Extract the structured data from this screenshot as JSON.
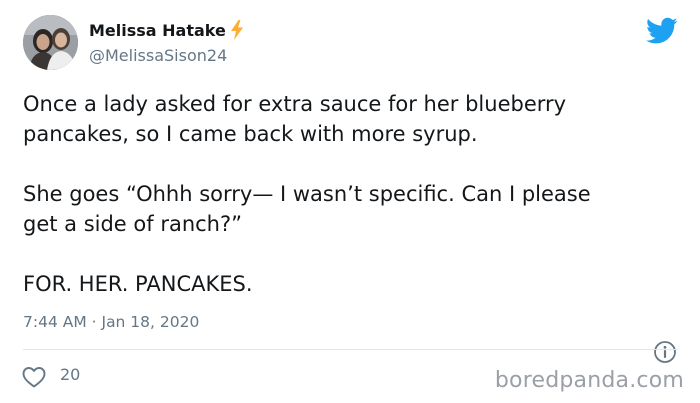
{
  "tweet": {
    "author": {
      "display_name": "Melissa Hatake",
      "handle": "@MelissaSison24",
      "avatar_icon": "profile-photo-avatar",
      "name_emoji_icon": "lightning-bolt-icon"
    },
    "text_lines": [
      "Once a lady asked for extra sauce for her blueberry",
      "pancakes, so I came back with more syrup.",
      "She goes “Ohhh sorry— I wasn’t specific. Can I please",
      "get a side of ranch?”",
      "FOR. HER. PANCAKES."
    ],
    "timestamp": "7:44 AM · Jan 18, 2020",
    "like_count": "20",
    "icons": {
      "brand": "twitter-bird-icon",
      "info": "info-icon",
      "like": "heart-icon"
    }
  },
  "watermark": "boredpanda.com",
  "colors": {
    "text": "#14171a",
    "secondary": "#657786",
    "twitter_blue": "#1da1f2",
    "bolt": "#ffac33",
    "divider": "#e1e8ed",
    "watermark": "#9aa0a6"
  }
}
